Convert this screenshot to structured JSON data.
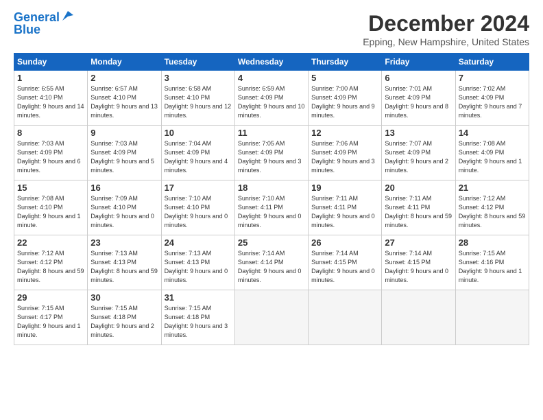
{
  "logo": {
    "line1": "General",
    "line2": "Blue"
  },
  "title": "December 2024",
  "location": "Epping, New Hampshire, United States",
  "days_of_week": [
    "Sunday",
    "Monday",
    "Tuesday",
    "Wednesday",
    "Thursday",
    "Friday",
    "Saturday"
  ],
  "weeks": [
    [
      {
        "day": "1",
        "sunrise": "6:55 AM",
        "sunset": "4:10 PM",
        "daylight": "9 hours and 14 minutes."
      },
      {
        "day": "2",
        "sunrise": "6:57 AM",
        "sunset": "4:10 PM",
        "daylight": "9 hours and 13 minutes."
      },
      {
        "day": "3",
        "sunrise": "6:58 AM",
        "sunset": "4:10 PM",
        "daylight": "9 hours and 12 minutes."
      },
      {
        "day": "4",
        "sunrise": "6:59 AM",
        "sunset": "4:09 PM",
        "daylight": "9 hours and 10 minutes."
      },
      {
        "day": "5",
        "sunrise": "7:00 AM",
        "sunset": "4:09 PM",
        "daylight": "9 hours and 9 minutes."
      },
      {
        "day": "6",
        "sunrise": "7:01 AM",
        "sunset": "4:09 PM",
        "daylight": "9 hours and 8 minutes."
      },
      {
        "day": "7",
        "sunrise": "7:02 AM",
        "sunset": "4:09 PM",
        "daylight": "9 hours and 7 minutes."
      }
    ],
    [
      {
        "day": "8",
        "sunrise": "7:03 AM",
        "sunset": "4:09 PM",
        "daylight": "9 hours and 6 minutes."
      },
      {
        "day": "9",
        "sunrise": "7:03 AM",
        "sunset": "4:09 PM",
        "daylight": "9 hours and 5 minutes."
      },
      {
        "day": "10",
        "sunrise": "7:04 AM",
        "sunset": "4:09 PM",
        "daylight": "9 hours and 4 minutes."
      },
      {
        "day": "11",
        "sunrise": "7:05 AM",
        "sunset": "4:09 PM",
        "daylight": "9 hours and 3 minutes."
      },
      {
        "day": "12",
        "sunrise": "7:06 AM",
        "sunset": "4:09 PM",
        "daylight": "9 hours and 3 minutes."
      },
      {
        "day": "13",
        "sunrise": "7:07 AM",
        "sunset": "4:09 PM",
        "daylight": "9 hours and 2 minutes."
      },
      {
        "day": "14",
        "sunrise": "7:08 AM",
        "sunset": "4:09 PM",
        "daylight": "9 hours and 1 minute."
      }
    ],
    [
      {
        "day": "15",
        "sunrise": "7:08 AM",
        "sunset": "4:10 PM",
        "daylight": "9 hours and 1 minute."
      },
      {
        "day": "16",
        "sunrise": "7:09 AM",
        "sunset": "4:10 PM",
        "daylight": "9 hours and 0 minutes."
      },
      {
        "day": "17",
        "sunrise": "7:10 AM",
        "sunset": "4:10 PM",
        "daylight": "9 hours and 0 minutes."
      },
      {
        "day": "18",
        "sunrise": "7:10 AM",
        "sunset": "4:11 PM",
        "daylight": "9 hours and 0 minutes."
      },
      {
        "day": "19",
        "sunrise": "7:11 AM",
        "sunset": "4:11 PM",
        "daylight": "9 hours and 0 minutes."
      },
      {
        "day": "20",
        "sunrise": "7:11 AM",
        "sunset": "4:11 PM",
        "daylight": "8 hours and 59 minutes."
      },
      {
        "day": "21",
        "sunrise": "7:12 AM",
        "sunset": "4:12 PM",
        "daylight": "8 hours and 59 minutes."
      }
    ],
    [
      {
        "day": "22",
        "sunrise": "7:12 AM",
        "sunset": "4:12 PM",
        "daylight": "8 hours and 59 minutes."
      },
      {
        "day": "23",
        "sunrise": "7:13 AM",
        "sunset": "4:13 PM",
        "daylight": "8 hours and 59 minutes."
      },
      {
        "day": "24",
        "sunrise": "7:13 AM",
        "sunset": "4:13 PM",
        "daylight": "9 hours and 0 minutes."
      },
      {
        "day": "25",
        "sunrise": "7:14 AM",
        "sunset": "4:14 PM",
        "daylight": "9 hours and 0 minutes."
      },
      {
        "day": "26",
        "sunrise": "7:14 AM",
        "sunset": "4:15 PM",
        "daylight": "9 hours and 0 minutes."
      },
      {
        "day": "27",
        "sunrise": "7:14 AM",
        "sunset": "4:15 PM",
        "daylight": "9 hours and 0 minutes."
      },
      {
        "day": "28",
        "sunrise": "7:15 AM",
        "sunset": "4:16 PM",
        "daylight": "9 hours and 1 minute."
      }
    ],
    [
      {
        "day": "29",
        "sunrise": "7:15 AM",
        "sunset": "4:17 PM",
        "daylight": "9 hours and 1 minute."
      },
      {
        "day": "30",
        "sunrise": "7:15 AM",
        "sunset": "4:18 PM",
        "daylight": "9 hours and 2 minutes."
      },
      {
        "day": "31",
        "sunrise": "7:15 AM",
        "sunset": "4:18 PM",
        "daylight": "9 hours and 3 minutes."
      },
      null,
      null,
      null,
      null
    ]
  ]
}
